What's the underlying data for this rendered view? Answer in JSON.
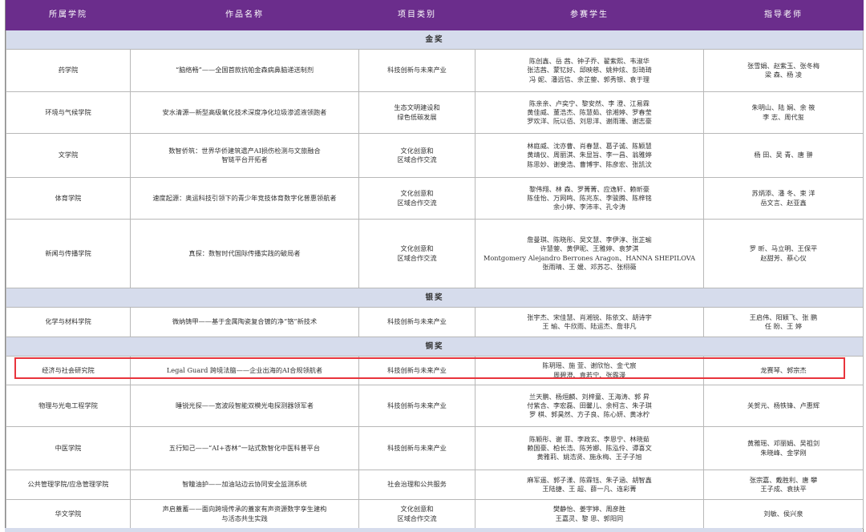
{
  "headers": {
    "school": "所属学院",
    "project": "作品名称",
    "category": "项目类别",
    "students": "参赛学生",
    "teachers": "指导老师"
  },
  "sections": {
    "gold": "金奖",
    "silver": "银奖",
    "bronze": "铜奖"
  },
  "gold_rows": [
    {
      "school": "药学院",
      "project": [
        "“脑络畅”——全国首款抗帕金森病鼻脑递送制剂"
      ],
      "category": [
        "科技创新与未来产业"
      ],
      "students": [
        "陈创鑫、岳 茜、钟子乔、翟紫熙、韦淑华",
        "张洁茜、蒙钇好、邱映慈、姚仲炫、彭琦琦",
        "冯 妮、潘远信、余芷蓥、郭秀银、袁于理"
      ],
      "teachers": [
        "张雪娟、赵紫玉、张冬梅",
        "梁 森、杨 凌"
      ]
    },
    {
      "school": "环境与气候学院",
      "project": [
        "安水清源—新型高级氧化技术深度净化垃圾渗滤液领跑者"
      ],
      "category": [
        "生态文明建设和",
        "绿色低碳发展"
      ],
      "students": [
        "陈亲亲、卢奕宁、黎安然、李 澄、江易霖",
        "黄佳威、董浩杰、陈慧茹、徐湘婷、罗春莹",
        "罗欢洋、阮以佰、刘思洋、谢雨珊、谢志豪"
      ],
      "teachers": [
        "朱明山、陆 娴、余 筱",
        "李 志、周代玺"
      ]
    },
    {
      "school": "文学院",
      "project": [
        "数智侨筑：世界华侨建筑遗产AI损伤检测与文旅融合",
        "智链平台开拓者"
      ],
      "category": [
        "文化创意和",
        "区域合作交流"
      ],
      "students": [
        "林庭威、沈亦曹、肖春慧、葛子诚、陈颖慧",
        "黄靖仪、周丽淇、朱显旨、李一昌、翁雅婷",
        "陈思妙、谢斐浩、曹博宇、陈彦宏、张凯汶"
      ],
      "teachers": [
        "杨 田、吴 青、唐 翀"
      ]
    },
    {
      "school": "体育学院",
      "project": [
        "速度起源：奥运科技引领下的青少年竞技体育数字化普惠领航者"
      ],
      "category": [
        "文化创意和",
        "区域合作交流"
      ],
      "students": [
        "黎伟翔、林 森、罗菁菁、应逸轩、赖昕豪",
        "陈佳怡、万网鸣、陈兆东、李骏腾、陈梓铭",
        "余小婷、李沛丰、孔令涛"
      ],
      "teachers": [
        "苏炳添、潘 冬、束 洋",
        "岳文言、赵亚鑫"
      ]
    },
    {
      "school": "新闻与传播学院",
      "project": [
        "真探：数智时代国际传播实践的破局者"
      ],
      "category": [
        "文化创意和",
        "区域合作交流"
      ],
      "students": [
        "詹曼琪、陈晓彤、吴文慧、李伊淳、张芷瑜",
        "许慧蓥、黄伊昵、王雅婷、袁梦淇",
        "Montgomery Alejandro Berrones Aragon、HANNA SHEPILOVA",
        "张雨晴、王 媛、邓苏芯、张栩薇"
      ],
      "teachers": [
        "罗 昕、马立明、王保平",
        "赵甜芳、蔡心仪"
      ]
    }
  ],
  "silver_rows": [
    {
      "school": "化学与材料学院",
      "project": [
        "微纳铸甲——基于金属陶瓷复合镀的净“铬”新技术"
      ],
      "category": [
        "科技创新与未来产业"
      ],
      "students": [
        "张宇杰、宋佳慧、肖湘锐、陈依文、胡诗宇",
        "王 瑜、牛欣雨、陆运杰、詹非凡"
      ],
      "teachers": [
        "王启伟、阳颖飞、张 鹏",
        "任 盼、王 婷"
      ]
    }
  ],
  "bronze_rows": [
    {
      "school": "经济与社会研究院",
      "project": [
        "Legal Guard 跨境法脑——企业出海的AI合规领航者"
      ],
      "category": [
        "科技创新与未来产业"
      ],
      "students": [
        "陈玥瑶、施 萱、谢欣怡、金弋宸",
        "周碧澄、袁若宁、张露漫"
      ],
      "teachers": [
        "龙赛琴、郭宗杰"
      ]
    },
    {
      "school": "物理与光电工程学院",
      "project": [
        "睡锐光探——宽波段智能双模光电探测器领军者"
      ],
      "category": [
        "科技创新与未来产业"
      ],
      "students": [
        "兰天鹏、杨烜麟、刘梓童、王海涛、郭 昇",
        "付紫含、李宏磊、田馨儿、余柯言、朱子琪",
        "罗 棋、郭昊然、方子良、陈心妍、黄冰柠"
      ],
      "teachers": [
        "关贺元、杨铁锋、卢惠辉"
      ]
    },
    {
      "school": "中医学院",
      "project": [
        "五行知己——“AI+杏林”一站式数智化中医科普平台"
      ],
      "category": [
        "科技创新与未来产业"
      ],
      "students": [
        "陈颖彤、谢 菲、李政玄、李恩宁、林晓茹",
        "赖国豪、柏长浩、陈芳娜、陈泓伶、谭喜文",
        "黄雅莉、姚浩贤、施永梅、王子子旭"
      ],
      "teachers": [
        "黄雅瑶、邓丽娟、吴祖剑",
        "朱晓峰、金学刚"
      ]
    },
    {
      "school": "公共管理学院/应急管理学院",
      "project": [
        "智瞳油护——加油站边云协同安全监测系统"
      ],
      "category": [
        "社会治理和公共服务"
      ],
      "students": [
        "麻军遥、郭子漾、陈霖钰、朱子涵、胡智鑫",
        "王陆捷、王 超、薛一凡、连彩菁"
      ],
      "teachers": [
        "张宗嘉、戴胜利、唐 攀",
        "王子成、袁扶平"
      ]
    },
    {
      "school": "华文学院",
      "project": [
        "声启蓋蓄——面向跨境传承的蓋家有声资源数字孪生建构",
        "与活态共生实践"
      ],
      "category": [
        "文化创意和",
        "区域合作交流"
      ],
      "students": [
        "樊静怡、姜宇婷、周彦胜",
        "王嘉灵、黎 思、郭阳同"
      ],
      "teachers": [
        "刘敏、侯兴泉"
      ]
    }
  ]
}
